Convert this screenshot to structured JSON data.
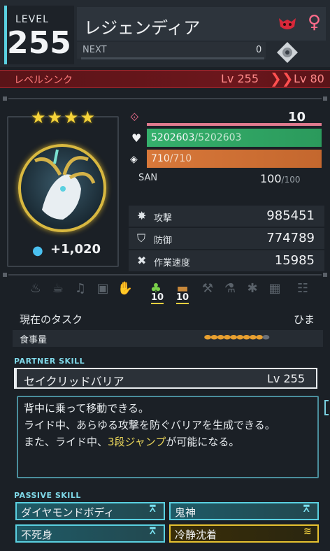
{
  "header": {
    "level_label": "LEVEL",
    "level_value": "255",
    "pal_name": "レジェンディア",
    "element_icon": "dark-element-icon",
    "gender_icon": "female-icon",
    "gender_symbol": "♀",
    "next_label": "NEXT",
    "next_value": "0"
  },
  "level_sync": {
    "label": "レベルシンク",
    "from": "Lv 255",
    "arrow": "❯❯",
    "to": "Lv 80"
  },
  "portrait": {
    "stars": "★★★★",
    "star_count": 4,
    "souls": "+1,020"
  },
  "stats": {
    "trust_value": "10",
    "hp_current": "5202603",
    "hp_max": "/5202603",
    "food_current": "710",
    "food_max": "/710",
    "san_label": "SAN",
    "san_value": "100",
    "san_max": "/100",
    "attack_label": "攻撃",
    "attack_value": "985451",
    "defense_label": "防御",
    "defense_value": "774789",
    "work_speed_label": "作業速度",
    "work_speed_value": "15985"
  },
  "work": {
    "icons": [
      "kindling-icon",
      "watering-icon",
      "seeding-icon",
      "electricity-icon",
      "handiwork-icon",
      "gathering-icon",
      "lumbering-icon",
      "mining-icon",
      "medicine-icon",
      "cooling-icon",
      "transporting-icon",
      "farming-icon"
    ],
    "gathering_level": "10",
    "lumbering_level": "10",
    "task_label": "現在のタスク",
    "task_value": "ひま",
    "food_label": "食事量",
    "food_icons": "🥖🥖🥖🥖🥖🥖🥖🥖🥖🥖",
    "food_amount_filled": 9,
    "food_amount_max": 10
  },
  "partner_skill": {
    "title": "PARTNER SKILL",
    "name": "セイクリッドバリア",
    "level": "Lv  255",
    "line1": "背中に乗って移動できる。",
    "line2": "ライド中、あらゆる攻撃を防ぐバリアを生成できる。",
    "line3_pre": "また、ライド中、",
    "line3_hl": "3段ジャンプ",
    "line3_post": "が可能になる。"
  },
  "passive_skills": {
    "title": "PASSIVE SKILL",
    "items": [
      {
        "name": "ダイヤモンドボディ",
        "rank": "rank-3-icon"
      },
      {
        "name": "鬼神",
        "rank": "rank-3-icon"
      },
      {
        "name": "不死身",
        "rank": "rank-3-icon"
      },
      {
        "name": "冷静沈着",
        "rank": "rank-gold-icon"
      }
    ]
  },
  "colors": {
    "hp_bar": "#35b06c",
    "food_bar": "#d8783a",
    "trust_bar": "#e07a8e",
    "sync_bg": "#6c161c",
    "accent_cyan": "#5ad0e0",
    "star_gold": "#f5d33a"
  }
}
